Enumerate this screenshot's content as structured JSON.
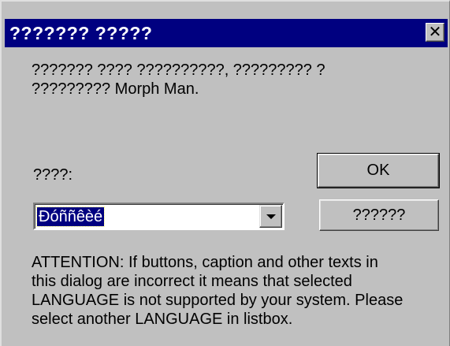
{
  "window": {
    "title": "??????? ?????",
    "close_glyph": "✕"
  },
  "message": {
    "line1": "??????? ???? ??????????, ????????? ?",
    "line2": "????????? Morph Man."
  },
  "language": {
    "label": "????:",
    "selected_value": "Ðóññêèé"
  },
  "buttons": {
    "ok_label": "OK",
    "other_label": "??????"
  },
  "attention": {
    "line1": "ATTENTION: If buttons, caption and other texts in",
    "line2": "this dialog are incorrect it means that selected",
    "line3": "LANGUAGE is not supported by your system. Please",
    "line4": "select another LANGUAGE in listbox."
  }
}
